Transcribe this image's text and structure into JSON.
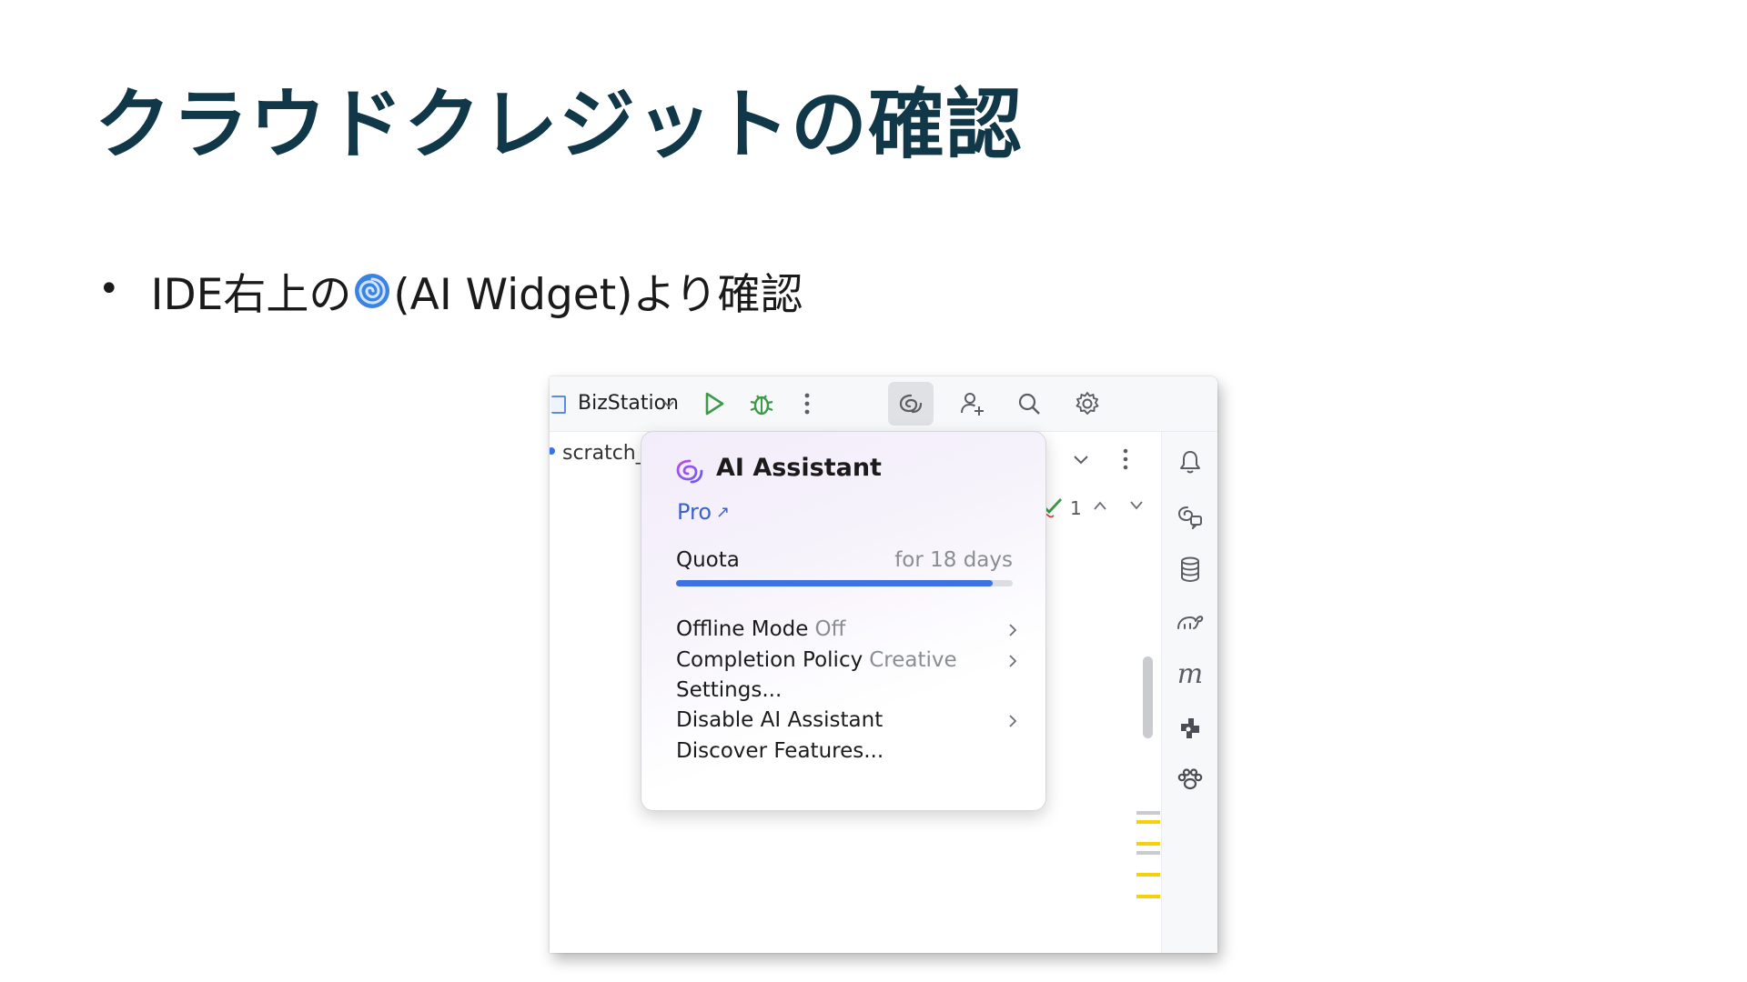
{
  "slide": {
    "title": "クラウドクレジットの確認",
    "bullet_prefix": "IDE右上の",
    "bullet_suffix": "(AI Widget)より確認",
    "bullet_icon": "cyclone-emoji-icon"
  },
  "ide": {
    "project_name": "BizStation",
    "tab_label": "scratch_",
    "inspection_count": "1",
    "quota_fraction": 0.94,
    "colors": {
      "run": "#3c9a48",
      "accent": "#3d73e0",
      "plan_link": "#3b62c9",
      "marker": "#f5d10a"
    },
    "toolbar_icons": [
      "run-icon",
      "debug-icon",
      "more-icon",
      "ai-assistant-icon",
      "add-user-icon",
      "search-icon",
      "settings-icon"
    ],
    "strip_icons": [
      "notifications-icon",
      "ai-chat-icon",
      "database-icon",
      "gradle-icon",
      "maven-icon",
      "plugin-icon",
      "paw-icon"
    ]
  },
  "popup": {
    "title": "AI Assistant",
    "plan": "Pro",
    "plan_arrow": "↗",
    "quota_label": "Quota",
    "quota_value": "for 18 days",
    "items": [
      {
        "label": "Offline Mode",
        "value": "Off",
        "has_submenu": true
      },
      {
        "label": "Completion Policy",
        "value": "Creative",
        "has_submenu": true
      },
      {
        "label": "Settings...",
        "value": "",
        "has_submenu": false
      },
      {
        "label": "Disable AI Assistant",
        "value": "",
        "has_submenu": true
      },
      {
        "label": "Discover Features...",
        "value": "",
        "has_submenu": false
      }
    ]
  }
}
